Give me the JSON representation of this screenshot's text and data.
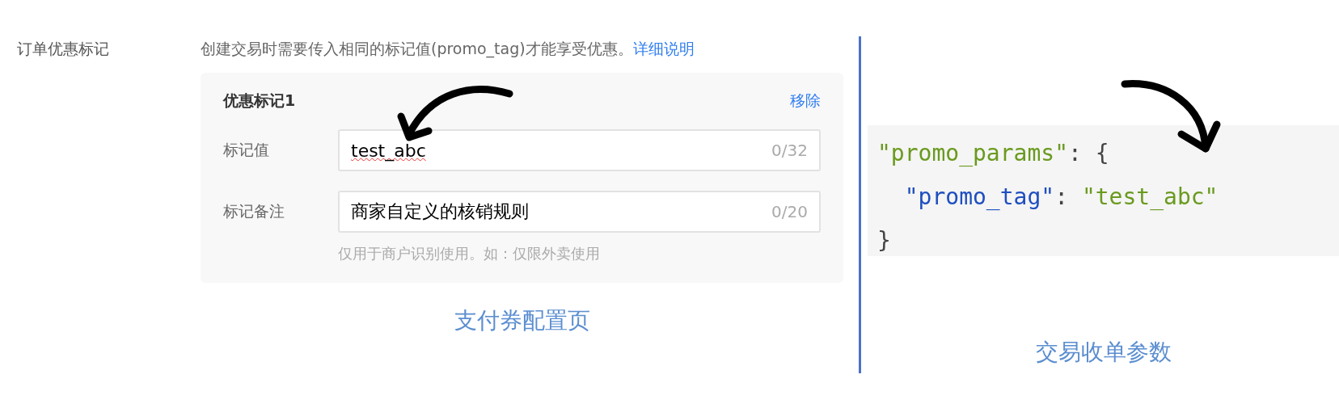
{
  "form": {
    "label": "订单优惠标记",
    "description": "创建交易时需要传入相同的标记值(promo_tag)才能享受优惠。",
    "help_link": "详细说明",
    "tag_card": {
      "title": "优惠标记1",
      "remove_link": "移除",
      "fields": [
        {
          "label": "标记值",
          "value": "test_abc",
          "counter": "0/32",
          "spellcheck_error": true
        },
        {
          "label": "标记备注",
          "value": "商家自定义的核销规则",
          "counter": "0/20",
          "spellcheck_error": false
        }
      ],
      "hint": "仅用于商户识别使用。如：仅限外卖使用"
    },
    "caption": "支付券配置页"
  },
  "code": {
    "lines": [
      [
        {
          "kind": "string",
          "text": "\"promo_params\""
        },
        {
          "kind": "punct",
          "text": ": {"
        }
      ],
      [
        {
          "kind": "key",
          "text": "  \"promo_tag\""
        },
        {
          "kind": "punct",
          "text": ": "
        },
        {
          "kind": "string",
          "text": "\"test_abc\""
        }
      ],
      [
        {
          "kind": "punct",
          "text": "}"
        }
      ]
    ],
    "caption": "交易收单参数"
  }
}
